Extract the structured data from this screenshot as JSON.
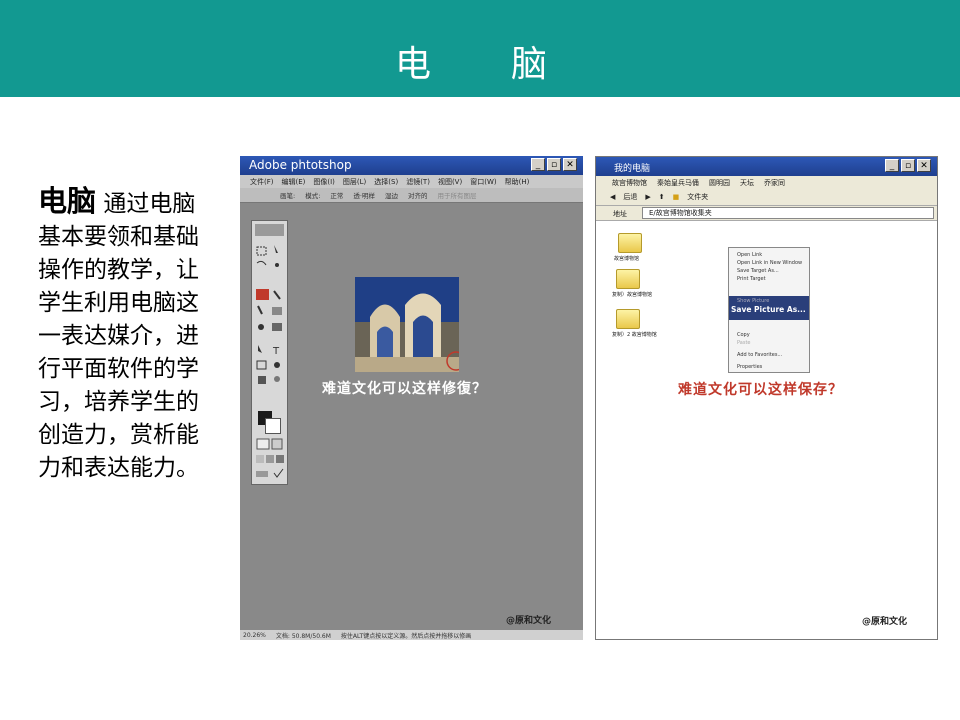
{
  "banner": {
    "title_char_1": "电",
    "title_char_2": "脑"
  },
  "description": {
    "highlight": "电脑",
    "text": " 通过电脑基本要领和基础操作的教学，让学生利用电脑这一表达媒介，进行平面软件的学习，培养学生的创造力，赏析能力和表达能力。"
  },
  "photoshop": {
    "title": "Adobe  phtotshop",
    "menu": [
      "文件(F)",
      "编辑(E)",
      "图像(I)",
      "图层(L)",
      "选择(S)",
      "滤镜(T)",
      "视图(V)",
      "窗口(W)",
      "帮助(H)"
    ],
    "options": [
      "画笔:",
      "模式:",
      "正常",
      "透·明样",
      "湿边",
      "对齐的",
      "用于所有图层"
    ],
    "caption": "难道文化可以这样修復？",
    "status": {
      "zoom": "20.26%",
      "doc": "文档: 50.8M/50.6M",
      "hint": "按住ALT键点按以定义源。然后点按并拖移以修画"
    },
    "logo": "@原和文化"
  },
  "my_computer": {
    "title": "我的电脑",
    "menu": [
      "故宫博物馆",
      "秦始皇兵马俑",
      "圆明园",
      "天坛",
      "乔家同"
    ],
    "toolbar": {
      "back": "后退",
      "folders": "文件夹"
    },
    "address_label": "地址",
    "address_value": "E/故宫博物馆收集夹",
    "folders": [
      "故宫博物馆",
      "复制）故宫博物馆",
      "复制）2 故宫博物馆"
    ],
    "context_menu": [
      "Open Link",
      "Open Link in New Window",
      "Save Target As...",
      "Print Target",
      "Show Picture",
      "Save Picture As...",
      "Copy",
      "Paste",
      "Add to Favorites...",
      "Properties"
    ],
    "caption": "难道文化可以这样保存？",
    "logo": "@原和文化"
  },
  "colors": {
    "banner": "#129991",
    "ps_background": "#898989",
    "caption_red": "#c0392b",
    "titlebar": "#2d58b6"
  }
}
